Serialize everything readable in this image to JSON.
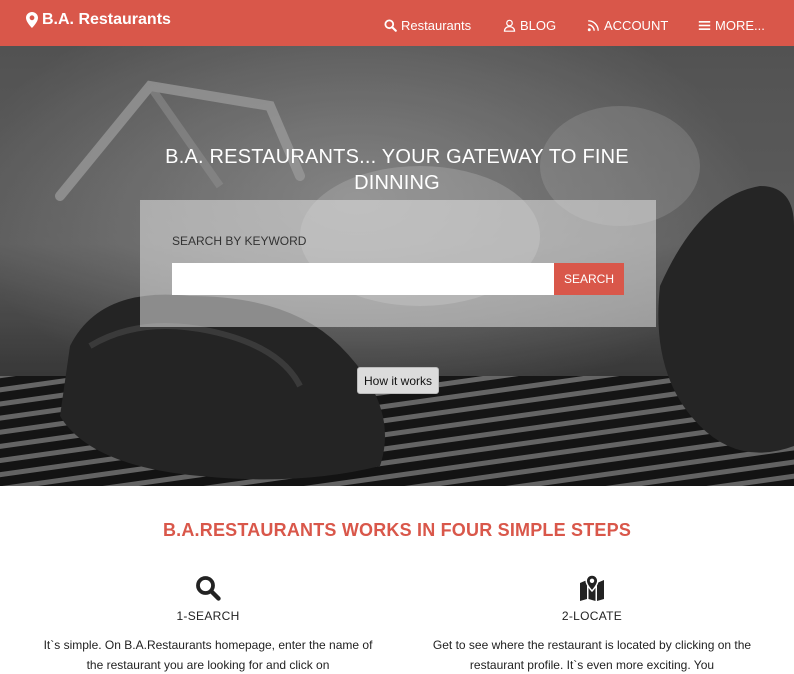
{
  "nav": {
    "brand": "B.A. Restaurants",
    "items": [
      {
        "label": "Restaurants",
        "icon": "search-icon"
      },
      {
        "label": "BLOG",
        "icon": "user-icon"
      },
      {
        "label": "ACCOUNT",
        "icon": "rss-icon"
      },
      {
        "label": "MORE...",
        "icon": "menu-icon"
      }
    ],
    "bar_color": "#d9574a"
  },
  "hero": {
    "title": "B.A. RESTAURANTS... YOUR GATEWAY TO FINE DINNING",
    "search_label": "SEARCH BY KEYWORD",
    "search_value": "",
    "search_button": "SEARCH",
    "how_button": "How it works"
  },
  "steps": {
    "heading": "B.A.RESTAURANTS WORKS IN FOUR SIMPLE STEPS",
    "items": [
      {
        "title": "1-SEARCH",
        "icon": "search-icon",
        "text": "It`s simple. On B.A.Restaurants homepage, enter the name of the restaurant you are looking for and click on"
      },
      {
        "title": "2-LOCATE",
        "icon": "map-pin-icon",
        "text": "Get to see where the restaurant is located by clicking on the restaurant profile. It`s even more exciting. You"
      }
    ]
  },
  "accent_color": "#d9574a"
}
